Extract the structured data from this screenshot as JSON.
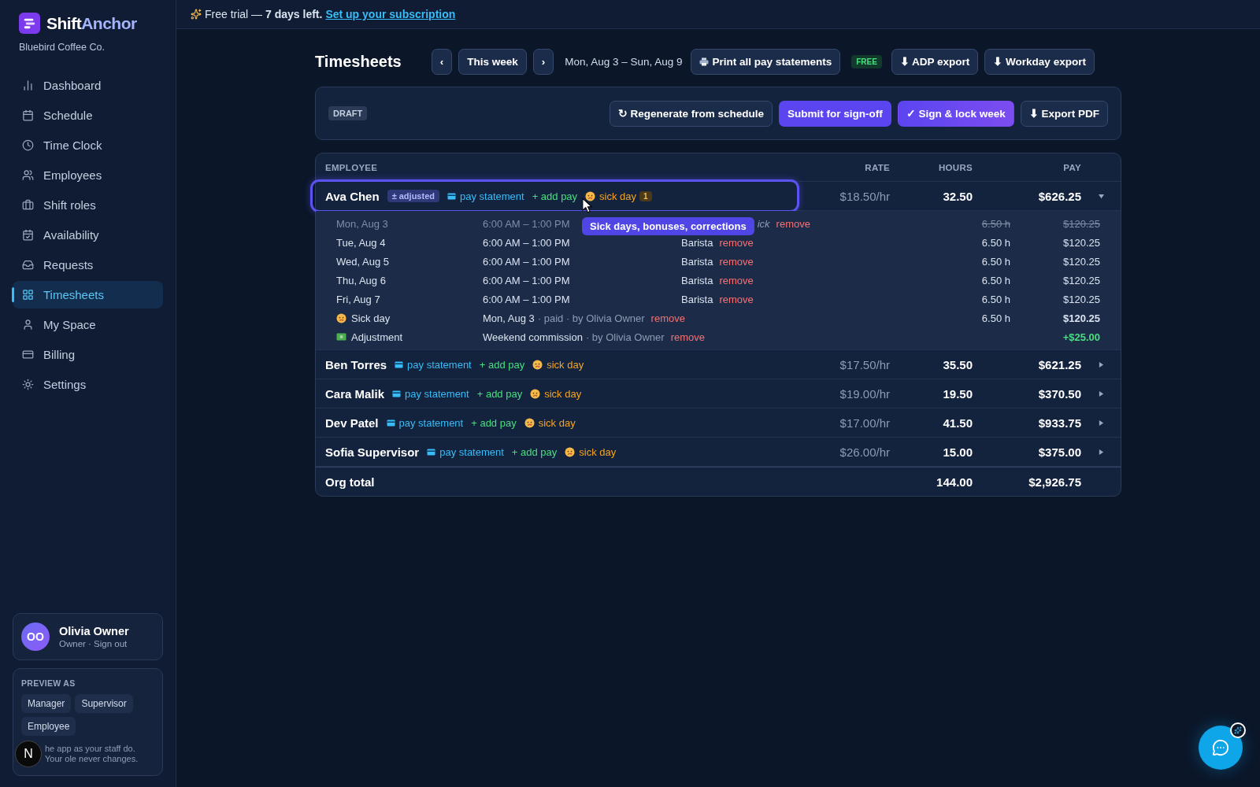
{
  "sidebar": {
    "brand": {
      "first": "Shift",
      "second": "Anchor"
    },
    "org": "Bluebird Coffee Co.",
    "nav": [
      {
        "label": "Dashboard",
        "selected": false
      },
      {
        "label": "Schedule",
        "selected": false
      },
      {
        "label": "Time Clock",
        "selected": false
      },
      {
        "label": "Employees",
        "selected": false
      },
      {
        "label": "Shift roles",
        "selected": false
      },
      {
        "label": "Availability",
        "selected": false
      },
      {
        "label": "Requests",
        "selected": false
      },
      {
        "label": "Timesheets",
        "selected": true
      },
      {
        "label": "My Space",
        "selected": false
      },
      {
        "label": "Billing",
        "selected": false
      },
      {
        "label": "Settings",
        "selected": false
      }
    ],
    "user": {
      "initials": "OO",
      "name": "Olivia Owner",
      "sub": "Owner · Sign out"
    },
    "preview": {
      "title": "PREVIEW AS",
      "roles": [
        "Manager",
        "Supervisor",
        "Employee"
      ],
      "note": "he app as your staff do. Your ole never changes."
    },
    "dev_badge": "N"
  },
  "banner": {
    "text": "Free trial — **7 days left.**",
    "link": "Set up your subscription"
  },
  "header": {
    "title": "Timesheets",
    "prev": "‹",
    "current": "This week",
    "next": "›",
    "range": "Mon, Aug 3 – Sun, Aug 9",
    "print": "Print all pay statements",
    "free_badge": "FREE",
    "exports": [
      "⬇ ADP export",
      "⬇ Workday export"
    ]
  },
  "toolbar": {
    "status": "DRAFT",
    "actions": [
      "↻ Regenerate from schedule",
      "Submit for sign-off",
      "✓ Sign & lock week",
      "⬇ Export PDF"
    ]
  },
  "table": {
    "columns": [
      "EMPLOYEE",
      "RATE",
      "HOURS",
      "PAY"
    ],
    "rows": [
      {
        "name": "Ava Chen",
        "adjusted": "± adjusted",
        "links": {
          "statement": "pay statement",
          "add": "+ add pay",
          "sick": "sick day"
        },
        "sick_count": "1",
        "rate": "$18.50/hr",
        "hours": "32.50",
        "pay": "$626.25",
        "expanded": true,
        "highlighted": true,
        "details": [
          {
            "kind": "shift",
            "struck": true,
            "day": "Mon, Aug 3",
            "time": "6:00 AM – 1:00 PM",
            "role": "ick",
            "remove": "remove",
            "hours": "6.50 h",
            "pay": "$120.25"
          },
          {
            "kind": "shift",
            "struck": false,
            "day": "Tue, Aug 4",
            "time": "6:00 AM – 1:00 PM",
            "role": "Barista",
            "remove": "remove",
            "hours": "6.50 h",
            "pay": "$120.25"
          },
          {
            "kind": "shift",
            "struck": false,
            "day": "Wed, Aug 5",
            "time": "6:00 AM – 1:00 PM",
            "role": "Barista",
            "remove": "remove",
            "hours": "6.50 h",
            "pay": "$120.25"
          },
          {
            "kind": "shift",
            "struck": false,
            "day": "Thu, Aug 6",
            "time": "6:00 AM – 1:00 PM",
            "role": "Barista",
            "remove": "remove",
            "hours": "6.50 h",
            "pay": "$120.25"
          },
          {
            "kind": "shift",
            "struck": false,
            "day": "Fri, Aug 7",
            "time": "6:00 AM – 1:00 PM",
            "role": "Barista",
            "remove": "remove",
            "hours": "6.50 h",
            "pay": "$120.25"
          },
          {
            "kind": "sick",
            "label": "Sick day",
            "what": "Mon, Aug 3",
            "meta": "· paid · by Olivia Owner",
            "remove": "remove",
            "hours": "6.50 h",
            "pay": "$120.25"
          },
          {
            "kind": "adjustment",
            "label": "Adjustment",
            "what": "Weekend commission",
            "meta": "· by Olivia Owner",
            "remove": "remove",
            "pay": "+$25.00"
          }
        ]
      },
      {
        "name": "Ben Torres",
        "links": {
          "statement": "pay statement",
          "add": "+ add pay",
          "sick": "sick day"
        },
        "rate": "$17.50/hr",
        "hours": "35.50",
        "pay": "$621.25",
        "expanded": false,
        "highlighted": false
      },
      {
        "name": "Cara Malik",
        "links": {
          "statement": "pay statement",
          "add": "+ add pay",
          "sick": "sick day"
        },
        "rate": "$19.00/hr",
        "hours": "19.50",
        "pay": "$370.50",
        "expanded": false,
        "highlighted": false
      },
      {
        "name": "Dev Patel",
        "links": {
          "statement": "pay statement",
          "add": "+ add pay",
          "sick": "sick day"
        },
        "rate": "$17.00/hr",
        "hours": "41.50",
        "pay": "$933.75",
        "expanded": false,
        "highlighted": false
      },
      {
        "name": "Sofia Supervisor",
        "links": {
          "statement": "pay statement",
          "add": "+ add pay",
          "sick": "sick day"
        },
        "rate": "$26.00/hr",
        "hours": "15.00",
        "pay": "$375.00",
        "expanded": false,
        "highlighted": false
      }
    ],
    "total": {
      "label": "Org total",
      "hours": "144.00",
      "pay": "$2,926.75"
    }
  },
  "tooltip": "Sick days, bonuses, corrections"
}
